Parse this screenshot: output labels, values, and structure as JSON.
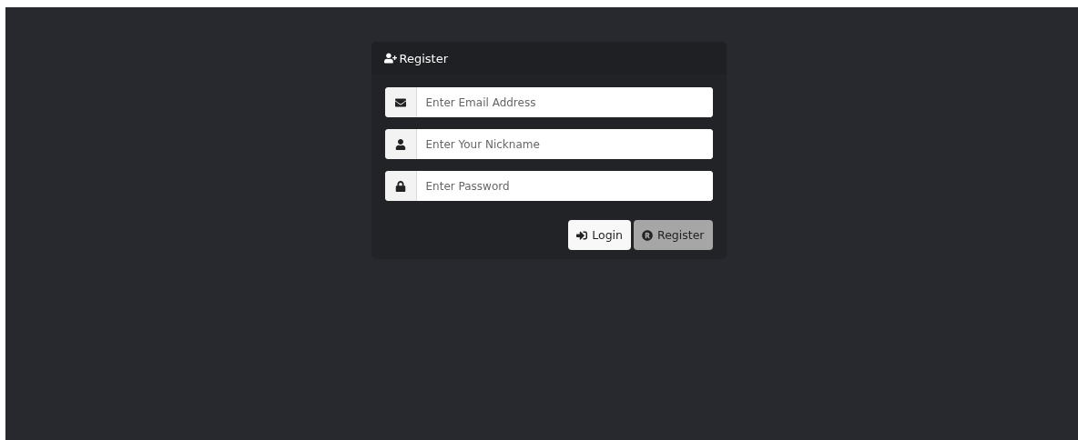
{
  "card": {
    "title": "Register"
  },
  "fields": [
    {
      "kind": "email",
      "placeholder": "Enter Email Address"
    },
    {
      "kind": "nickname",
      "placeholder": "Enter Your Nickname"
    },
    {
      "kind": "password",
      "placeholder": "Enter Password"
    }
  ],
  "buttons": [
    {
      "kind": "login",
      "label": "Login",
      "disabled": false
    },
    {
      "kind": "register",
      "label": "Register",
      "disabled": true
    }
  ]
}
